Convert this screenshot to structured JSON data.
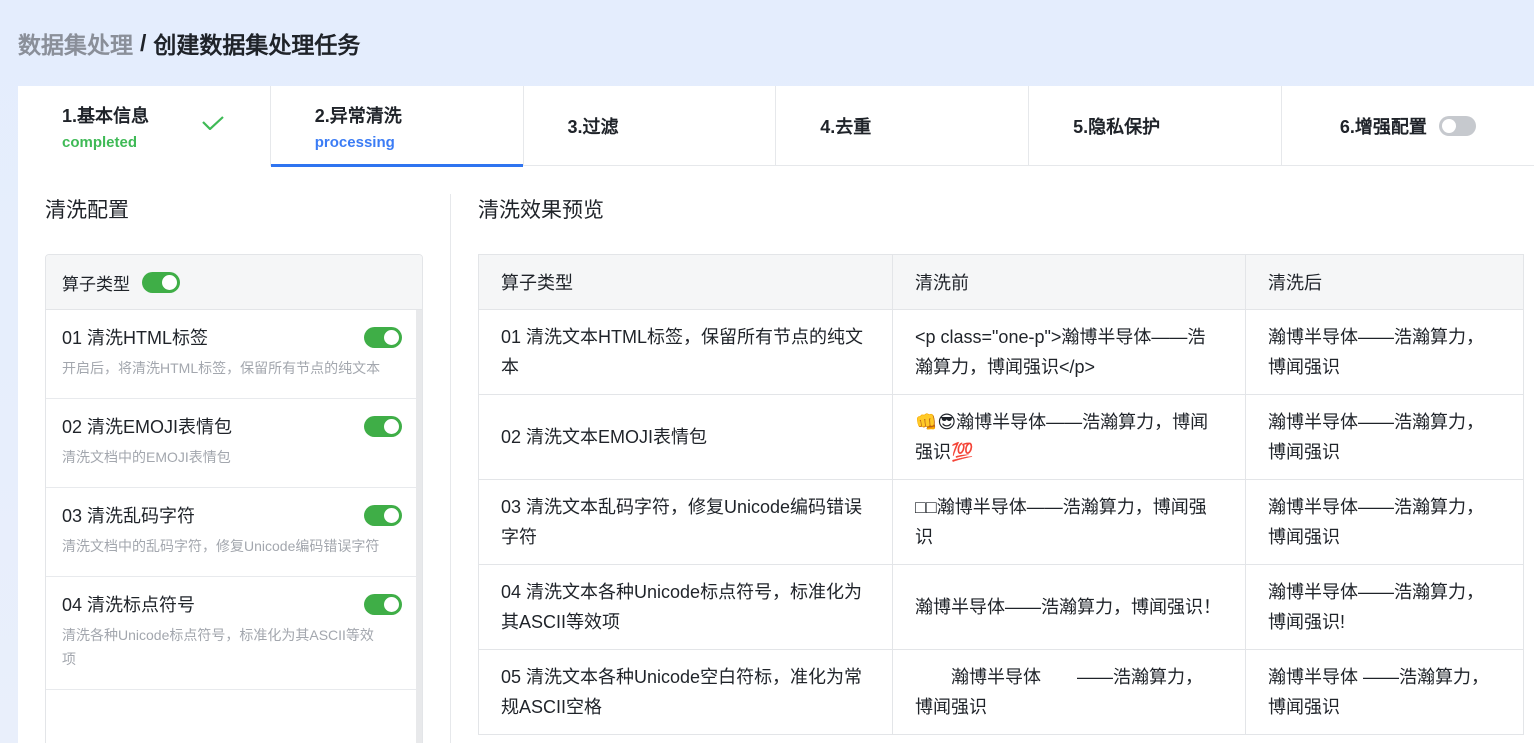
{
  "breadcrumb": {
    "parent": "数据集处理",
    "separator": "/",
    "current": "创建数据集处理任务"
  },
  "steps": [
    {
      "title": "1.基本信息",
      "status": "completed"
    },
    {
      "title": "2.异常清洗",
      "status": "processing"
    },
    {
      "title": "3.过滤"
    },
    {
      "title": "4.去重"
    },
    {
      "title": "5.隐私保护"
    },
    {
      "title": "6.增强配置"
    }
  ],
  "left": {
    "title": "清洗配置",
    "header": "算子类型",
    "items": [
      {
        "name": "01 清洗HTML标签",
        "desc": "开启后，将清洗HTML标签，保留所有节点的纯文本"
      },
      {
        "name": "02 清洗EMOJI表情包",
        "desc": "清洗文档中的EMOJI表情包"
      },
      {
        "name": "03 清洗乱码字符",
        "desc": "清洗文档中的乱码字符，修复Unicode编码错误字符"
      },
      {
        "name": "04 清洗标点符号",
        "desc": "清洗各种Unicode标点符号，标准化为其ASCII等效项"
      }
    ]
  },
  "right": {
    "title": "清洗效果预览",
    "columns": [
      "算子类型",
      "清洗前",
      "清洗后"
    ],
    "rows": [
      {
        "type": "01 清洗文本HTML标签，保留所有节点的纯文本",
        "before": "<p class=\"one-p\">瀚博半导体——浩瀚算力，博闻强识</p>",
        "after": "瀚博半导体——浩瀚算力，博闻强识"
      },
      {
        "type": "02 清洗文本EMOJI表情包",
        "before": "👊😎瀚博半导体——浩瀚算力，博闻强识💯",
        "after": "瀚博半导体——浩瀚算力，博闻强识"
      },
      {
        "type": "03 清洗文本乱码字符，修复Unicode编码错误字符",
        "before": "□□瀚博半导体——浩瀚算力，博闻强识",
        "after": "瀚博半导体——浩瀚算力，博闻强识"
      },
      {
        "type": "04 清洗文本各种Unicode标点符号，标准化为其ASCII等效项",
        "before": "瀚博半导体——浩瀚算力，博闻强识！",
        "after": "瀚博半导体——浩瀚算力，博闻强识!"
      },
      {
        "type": "05 清洗文本各种Unicode空白符标，准化为常规ASCII空格",
        "before": "　　瀚博半导体　　——浩瀚算力，　博闻强识",
        "after": "瀚博半导体 ——浩瀚算力， 博闻强识"
      }
    ]
  },
  "colors": {
    "accent": "#2f74f0",
    "success": "#3fba56",
    "toggle_on": "#3fae47"
  }
}
